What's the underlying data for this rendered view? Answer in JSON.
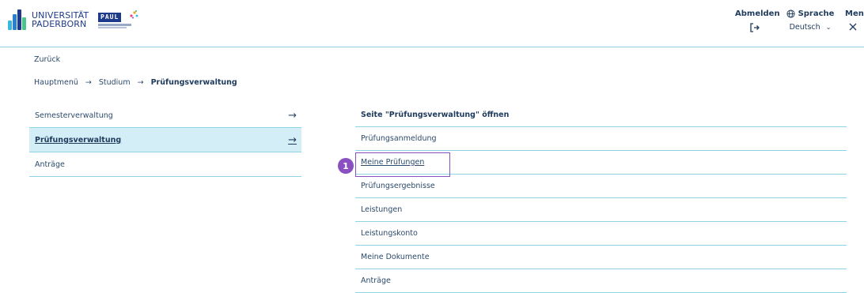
{
  "header": {
    "uni_logo_line1": "UNIVERSITÄT",
    "uni_logo_line2": "PADERBORN",
    "paul_logo_text": "PAUL",
    "logout_label": "Abmelden",
    "logout_icon": "logout-icon",
    "language_label": "Sprache",
    "language_icon": "globe-icon",
    "language_value": "Deutsch",
    "menu_label": "Menü",
    "menu_icon": "close-icon"
  },
  "nav": {
    "back_label": "Zurück",
    "breadcrumb": [
      "Hauptmenü",
      "Studium",
      "Prüfungsverwaltung"
    ]
  },
  "left_menu": {
    "items": [
      {
        "label": "Semesterverwaltung",
        "arrow": "→"
      },
      {
        "label": "Prüfungsverwaltung",
        "arrow": "→",
        "active": true
      },
      {
        "label": "Anträge",
        "arrow": ""
      }
    ]
  },
  "right_menu": {
    "open_page": "Seite \"Prüfungsverwaltung\" öffnen",
    "items": [
      "Prüfungsanmeldung",
      "Meine Prüfungen",
      "Prüfungsergebnisse",
      "Leistungen",
      "Leistungskonto",
      "Meine Dokumente",
      "Anträge"
    ]
  },
  "annotation": {
    "marker_number": "1",
    "marker_color": "#8a4fc0"
  },
  "colors": {
    "primary_text": "#1e3a5c",
    "divider": "#8fd3e6",
    "active_bg": "#d3eef7",
    "logo_blue": "#1e3a8a"
  }
}
